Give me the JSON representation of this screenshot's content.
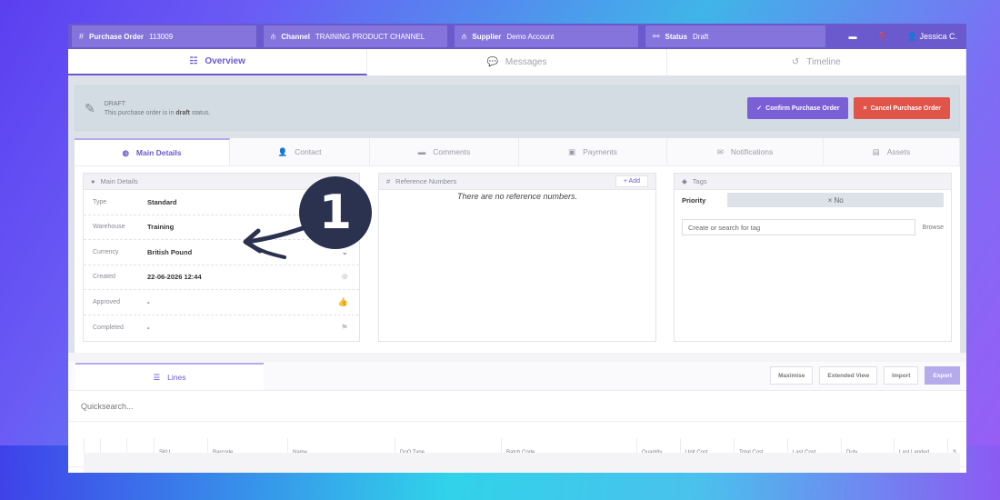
{
  "topbar": {
    "po_label": "Purchase Order",
    "po_number": "113009",
    "channel_label": "Channel",
    "channel_value": "TRAINING PRODUCT CHANNEL",
    "supplier_label": "Supplier",
    "supplier_value": "Demo Account",
    "status_label": "Status",
    "status_value": "Draft",
    "user_name": "Jessica C."
  },
  "main_tabs": [
    "Overview",
    "Messages",
    "Timeline"
  ],
  "draft_banner": {
    "title": "DRAFT",
    "message_pre": "This purchase order is in ",
    "message_bold": "draft",
    "message_post": " status.",
    "confirm_label": "Confirm Purchase Order",
    "cancel_label": "Cancel Purchase Order"
  },
  "sub_tabs": [
    "Main Details",
    "Contact",
    "Comments",
    "Payments",
    "Notifications",
    "Assets"
  ],
  "main_details": {
    "header": "Main Details",
    "rows": [
      {
        "key": "Type",
        "value": "Standard"
      },
      {
        "key": "Warehouse",
        "value": "Training"
      },
      {
        "key": "Currency",
        "value": "British Pound"
      },
      {
        "key": "Created",
        "value": "22-06-2026 12:44"
      },
      {
        "key": "Approved",
        "value": "-"
      },
      {
        "key": "Completed",
        "value": "-"
      }
    ]
  },
  "reference_numbers": {
    "header": "Reference Numbers",
    "add_label": "+ Add",
    "empty_text": "There are no reference numbers."
  },
  "tags": {
    "header": "Tags",
    "priority_label": "Priority",
    "priority_value": "× No",
    "search_placeholder": "Create or search for tag",
    "browse_label": "Browse"
  },
  "lines": {
    "tab_label": "Lines",
    "buttons": [
      "Maximise",
      "Extended View",
      "Import",
      "Export"
    ],
    "quicksearch_placeholder": "Quicksearch...",
    "columns": [
      "SKU",
      "Barcode",
      "Name",
      "DoQ Type",
      "Batch Code",
      "Quantity",
      "Unit Cost",
      "Total Cost",
      "Last Cost",
      "Duty",
      "Last Landed",
      "S"
    ]
  },
  "callout_number": "1",
  "colors": {
    "brand": "#6a5acd",
    "confirm": "#7b5fd6",
    "cancel": "#e0544a",
    "callout": "#2b3250"
  }
}
